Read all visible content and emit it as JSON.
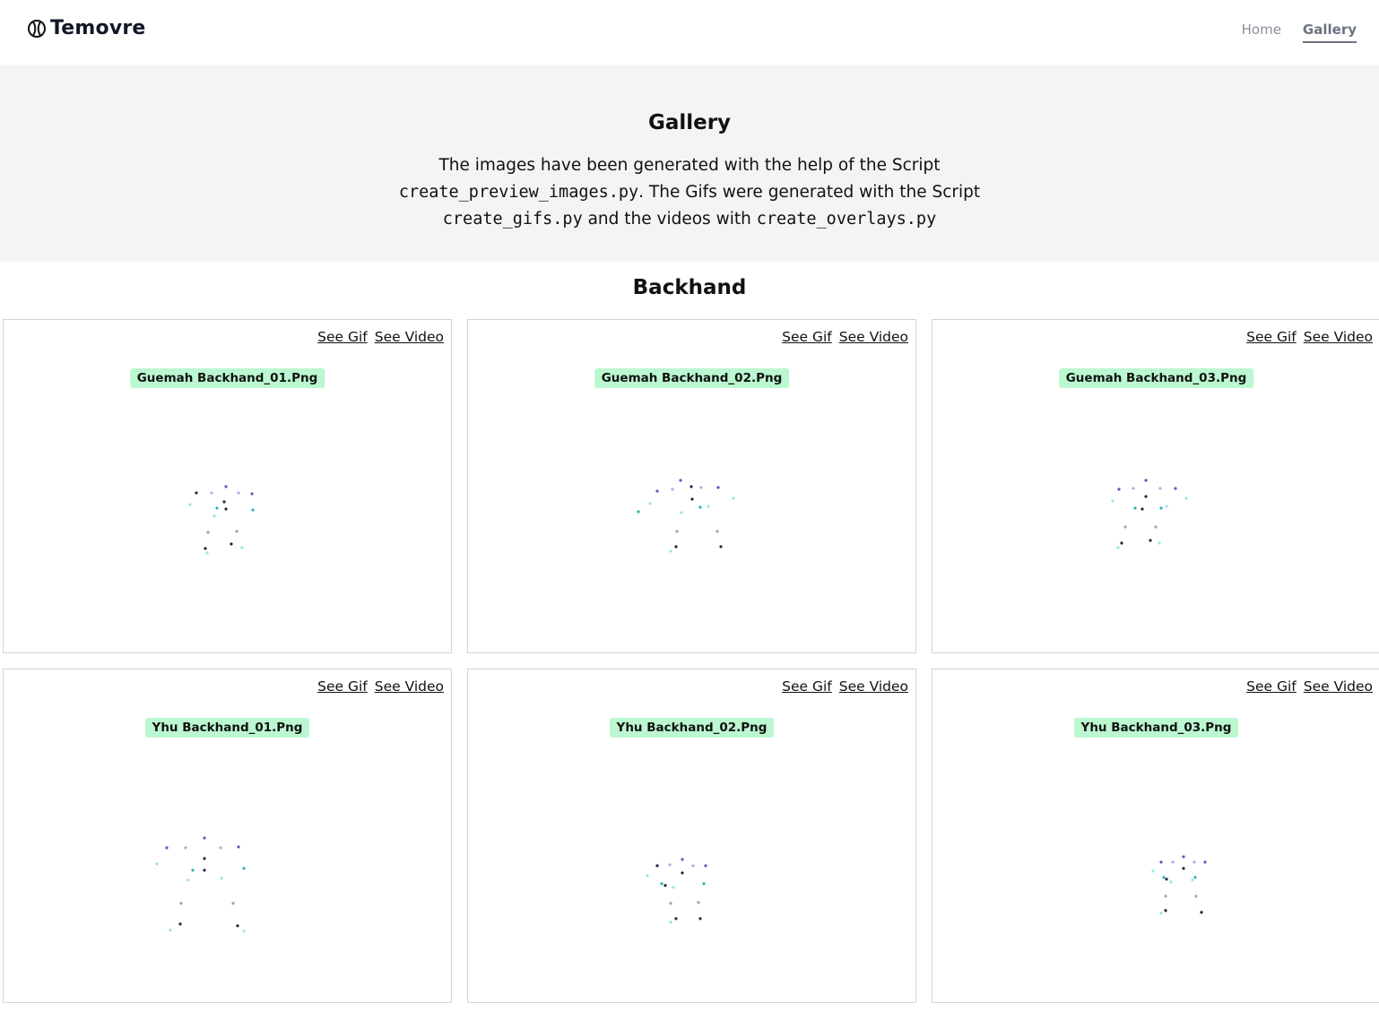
{
  "header": {
    "brand": "Temovre",
    "nav": [
      {
        "label": "Home",
        "active": false
      },
      {
        "label": "Gallery",
        "active": true
      }
    ]
  },
  "hero": {
    "title": "Gallery",
    "line1": "The images have been generated with the help of the Script",
    "script1": "create_preview_images.py",
    "line2": ". The Gifs were generated with the Script",
    "script2": "create_gifs.py",
    "line3": " and the videos with ",
    "script3": "create_overlays.py"
  },
  "section": {
    "title": "Backhand"
  },
  "cards": [
    {
      "name": "Guemah Backhand_01.Png",
      "gif_label": "See Gif",
      "video_label": "See Video"
    },
    {
      "name": "Guemah Backhand_02.Png",
      "gif_label": "See Gif",
      "video_label": "See Video"
    },
    {
      "name": "Guemah Backhand_03.Png",
      "gif_label": "See Gif",
      "video_label": "See Video"
    },
    {
      "name": "Yhu Backhand_01.Png",
      "gif_label": "See Gif",
      "video_label": "See Video"
    },
    {
      "name": "Yhu Backhand_02.Png",
      "gif_label": "See Gif",
      "video_label": "See Video"
    },
    {
      "name": "Yhu Backhand_03.Png",
      "gif_label": "See Gif",
      "video_label": "See Video"
    }
  ],
  "colors": {
    "badge": "#bbf7d0",
    "hero_bg": "#f3f4f6",
    "point_dark": "#1f2937",
    "point_purple": "#6d4fc2",
    "point_teal": "#2bb3b8"
  }
}
